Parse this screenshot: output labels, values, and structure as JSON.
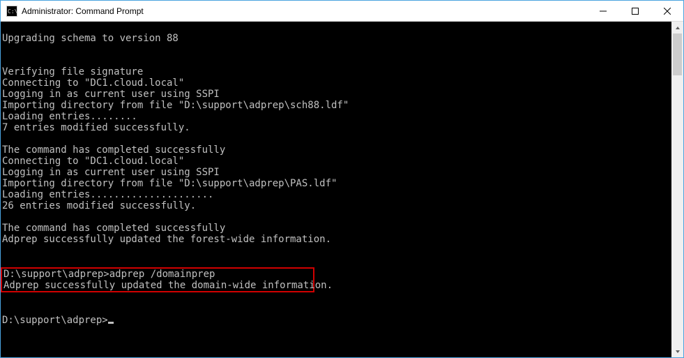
{
  "window": {
    "title": "Administrator: Command Prompt"
  },
  "console": {
    "lines": [
      "",
      "Upgrading schema to version 88",
      "",
      "",
      "Verifying file signature",
      "Connecting to \"DC1.cloud.local\"",
      "Logging in as current user using SSPI",
      "Importing directory from file \"D:\\support\\adprep\\sch88.ldf\"",
      "Loading entries........",
      "7 entries modified successfully.",
      "",
      "The command has completed successfully",
      "Connecting to \"DC1.cloud.local\"",
      "Logging in as current user using SSPI",
      "Importing directory from file \"D:\\support\\adprep\\PAS.ldf\"",
      "Loading entries.....................",
      "26 entries modified successfully.",
      "",
      "The command has completed successfully",
      "Adprep successfully updated the forest-wide information.",
      "",
      ""
    ],
    "highlighted": [
      "D:\\support\\adprep>adprep /domainprep",
      "Adprep successfully updated the domain-wide information."
    ],
    "tail": [
      "",
      ""
    ],
    "prompt": "D:\\support\\adprep>"
  }
}
